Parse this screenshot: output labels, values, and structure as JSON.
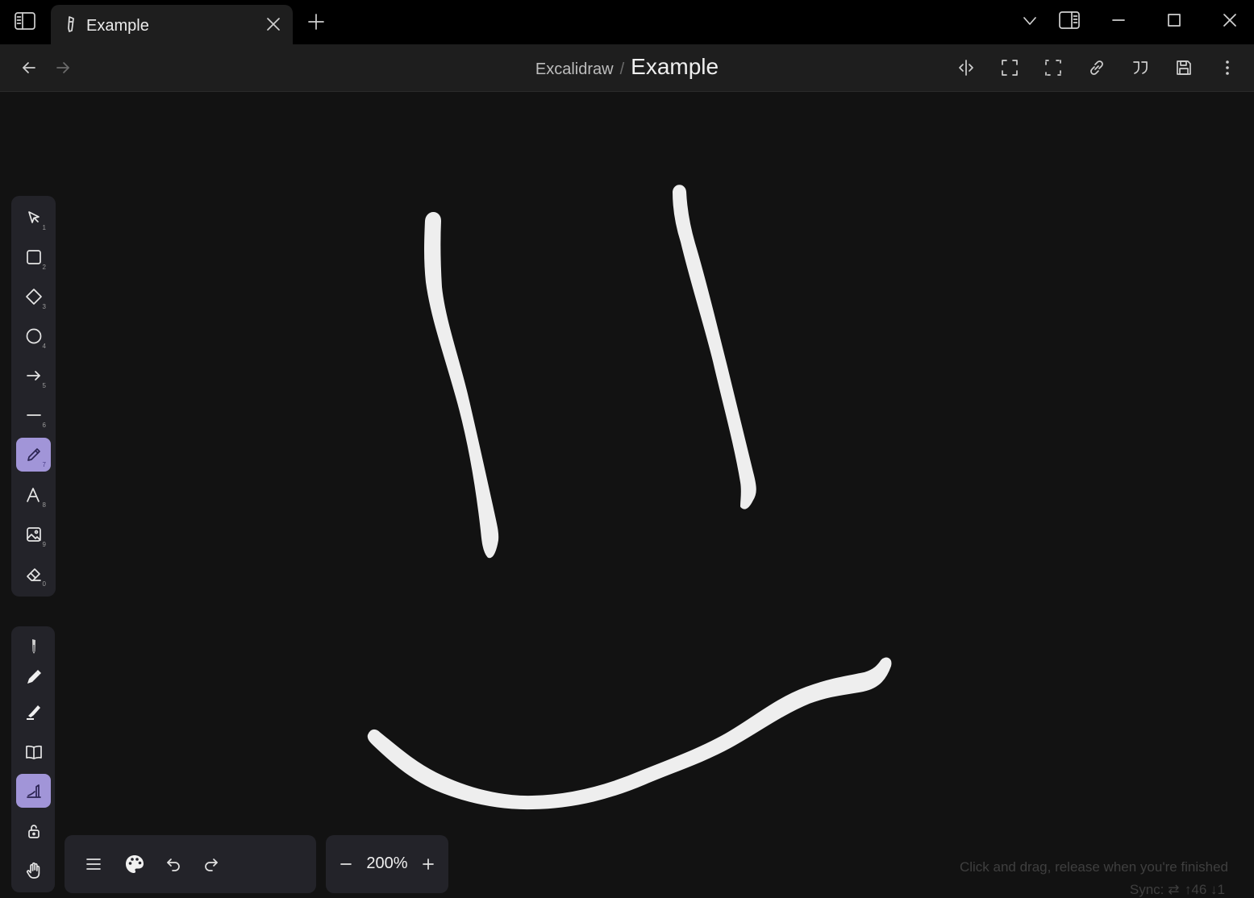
{
  "window": {
    "tab_title": "Example",
    "tab_icon": "excalidraw-pencil-icon"
  },
  "nav": {
    "breadcrumb_parent": "Excalidraw",
    "breadcrumb_separator": "/",
    "breadcrumb_current": "Example"
  },
  "toolbar": {
    "tools": [
      {
        "name": "selection",
        "key": "1"
      },
      {
        "name": "rectangle",
        "key": "2"
      },
      {
        "name": "diamond",
        "key": "3"
      },
      {
        "name": "ellipse",
        "key": "4"
      },
      {
        "name": "arrow",
        "key": "5"
      },
      {
        "name": "line",
        "key": "6"
      },
      {
        "name": "draw",
        "key": "7",
        "active": true
      },
      {
        "name": "text",
        "key": "8"
      },
      {
        "name": "image",
        "key": "9"
      },
      {
        "name": "eraser",
        "key": "0"
      }
    ],
    "pens": [
      "fountain-pen",
      "marker",
      "highlighter",
      "library",
      "custom-pen-active",
      "lock",
      "hand"
    ]
  },
  "zoom": {
    "level": "200%"
  },
  "status": {
    "hint": "Click and drag, release when you're finished",
    "sync_label": "Sync:",
    "sync_up": "↑46",
    "sync_down": "↓1"
  },
  "colors": {
    "accent": "#a195d8",
    "background": "#121212",
    "stroke": "#eeeeee"
  }
}
